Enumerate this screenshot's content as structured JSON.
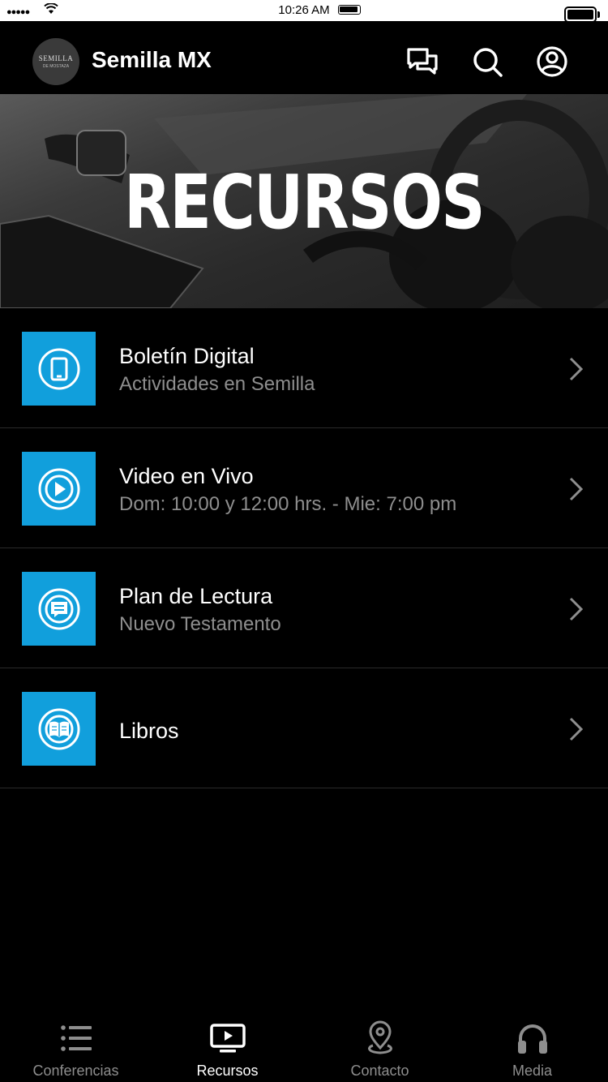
{
  "status_bar": {
    "signal": "●●●●●",
    "time": "10:26 AM"
  },
  "header": {
    "title": "Semilla MX",
    "logo_text": "SEMILLA",
    "logo_sub": "DE MOSTAZA"
  },
  "banner": {
    "title": "RECURSOS"
  },
  "items": [
    {
      "title": "Boletín Digital",
      "subtitle": "Actividades en Semilla",
      "icon": "tablet-icon"
    },
    {
      "title": "Video en Vivo",
      "subtitle": "Dom: 10:00 y 12:00 hrs. - Mie: 7:00 pm",
      "icon": "play-icon"
    },
    {
      "title": "Plan de Lectura",
      "subtitle": "Nuevo Testamento",
      "icon": "chat-icon"
    },
    {
      "title": "Libros",
      "subtitle": "",
      "icon": "book-icon"
    }
  ],
  "tabs": [
    {
      "label": "Conferencias",
      "icon": "list-icon",
      "active": false
    },
    {
      "label": "Recursos",
      "icon": "tv-play-icon",
      "active": true
    },
    {
      "label": "Contacto",
      "icon": "location-pin-icon",
      "active": false
    },
    {
      "label": "Media",
      "icon": "headphones-icon",
      "active": false
    }
  ],
  "colors": {
    "accent": "#119fdc",
    "background": "#000000",
    "subtitle": "#8e8e8e",
    "inactive_tab": "#8e8e8e"
  }
}
